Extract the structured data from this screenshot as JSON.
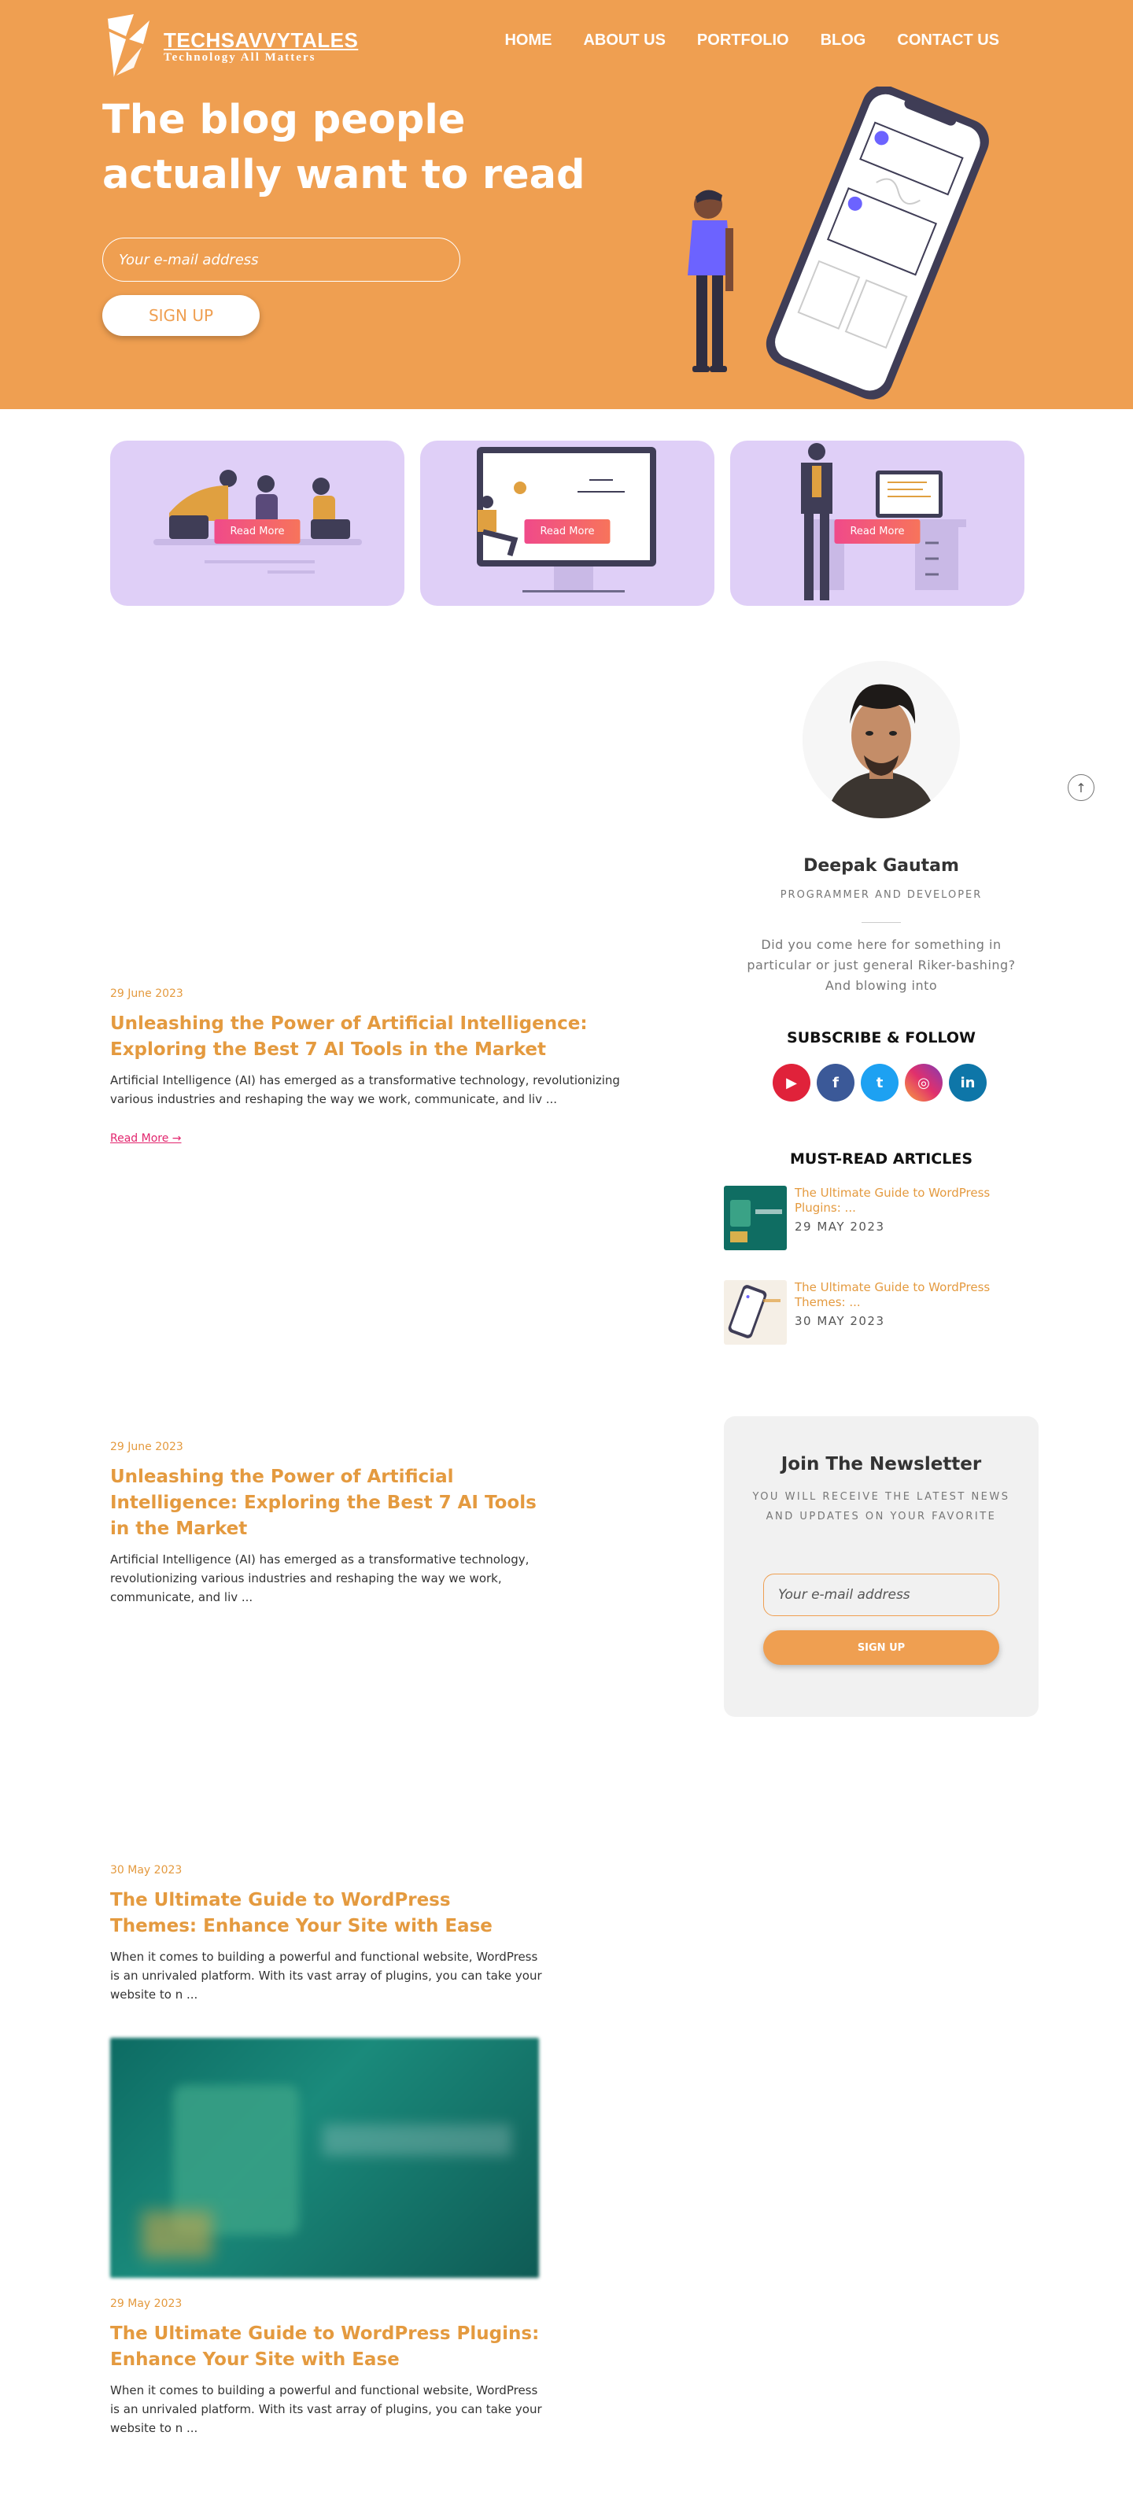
{
  "brand": {
    "name": "TECHSAVVYTALES",
    "tagline": "Technology All Matters",
    "accent": "#ef9f51",
    "link_color": "#e49a3f",
    "pink": "#e2266e"
  },
  "nav": {
    "items": [
      {
        "label": "HOME"
      },
      {
        "label": "ABOUT US"
      },
      {
        "label": "PORTFOLIO"
      },
      {
        "label": "BLOG"
      },
      {
        "label": "CONTACT US"
      }
    ]
  },
  "hero": {
    "title": "The blog people actually want to read",
    "email_placeholder": "Your e-mail address",
    "signup_label": "SIGN UP"
  },
  "cards": [
    {
      "button": "Read More"
    },
    {
      "button": "Read More"
    },
    {
      "button": "Read More"
    }
  ],
  "posts": [
    {
      "date": "29 June 2023",
      "title": "Unleashing the Power of Artificial Intelligence: Exploring the Best 7 AI Tools in the Market",
      "excerpt": "Artificial Intelligence (AI) has emerged as a transformative technology, revolutionizing various industries and reshaping the way we work, communicate, and liv ...",
      "read_more": "Read More →"
    },
    {
      "date": "29 June 2023",
      "title": "Unleashing the Power of Artificial Intelligence: Exploring the Best 7 AI Tools in the Market",
      "excerpt": "Artificial Intelligence (AI) has emerged as a transformative technology, revolutionizing various industries and reshaping the way we work, communicate, and liv ..."
    },
    {
      "date": "30 May 2023",
      "title": "The Ultimate Guide to WordPress Themes: Enhance Your Site with Ease",
      "excerpt": "When it comes to building a powerful and functional website, WordPress is an unrivaled platform. With its vast array of plugins, you can take your website to n ..."
    },
    {
      "date": "29 May 2023",
      "title": "The Ultimate Guide to WordPress Plugins: Enhance Your Site with Ease",
      "excerpt": "When it comes to building a powerful and functional website, WordPress is an unrivaled platform. With its vast array of plugins, you can take your website to n ..."
    }
  ],
  "author": {
    "name": "Deepak Gautam",
    "role": "PROGRAMMER AND DEVELOPER",
    "bio": "Did you come here for something in particular or just general Riker-bashing? And blowing into"
  },
  "subscribe": {
    "heading": "SUBSCRIBE & FOLLOW",
    "socials": [
      {
        "icon": "youtube-icon",
        "glyph": "▶",
        "color": "#e0223a"
      },
      {
        "icon": "facebook-icon",
        "glyph": "f",
        "color": "#3b5998"
      },
      {
        "icon": "twitter-icon",
        "glyph": "t",
        "color": "#1da1f2"
      },
      {
        "icon": "instagram-icon",
        "glyph": "◎",
        "color": "#e1306c"
      },
      {
        "icon": "linkedin-icon",
        "glyph": "in",
        "color": "#0e76a8"
      }
    ]
  },
  "must_read": {
    "heading": "MUST-READ ARTICLES",
    "articles": [
      {
        "title": "The Ultimate Guide to WordPress Plugins: ...",
        "date": "29 MAY 2023"
      },
      {
        "title": "The Ultimate Guide to WordPress Themes: ...",
        "date": "30 MAY 2023"
      }
    ]
  },
  "newsletter": {
    "title": "Join The Newsletter",
    "subtitle": "YOU WILL RECEIVE THE LATEST NEWS AND UPDATES ON YOUR FAVORITE",
    "placeholder": "Your e-mail address",
    "button": "SIGN UP"
  },
  "back_to_top": "↑"
}
